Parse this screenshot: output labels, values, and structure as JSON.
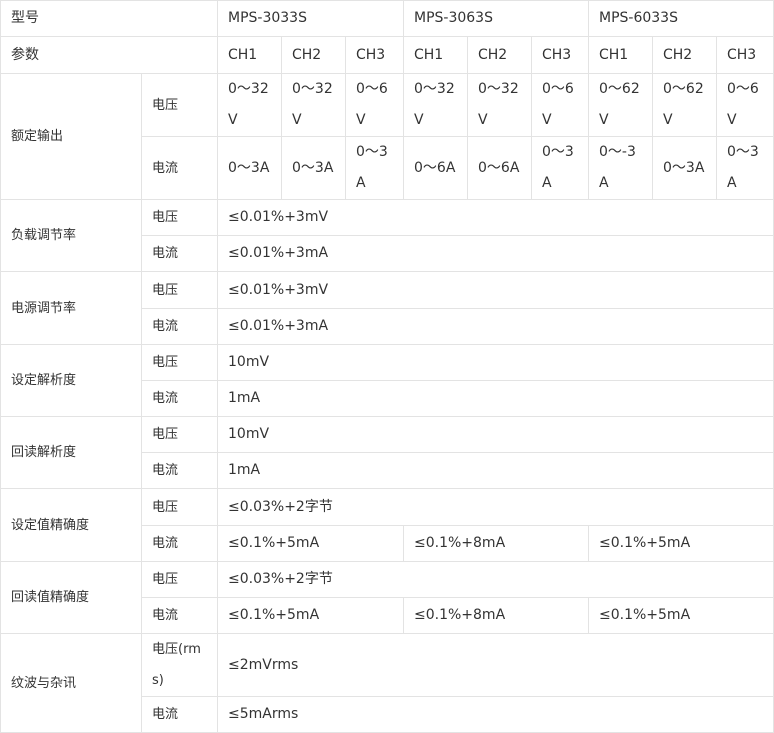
{
  "header": {
    "model_label": "型号",
    "models": [
      "MPS-3033S",
      "MPS-3063S",
      "MPS-6033S"
    ],
    "param_label": "参数",
    "channels": [
      "CH1",
      "CH2",
      "CH3",
      "CH1",
      "CH2",
      "CH3",
      "CH1",
      "CH2",
      "CH3"
    ]
  },
  "rated_output": {
    "label": "额定输出",
    "voltage_label": "电压",
    "voltage_values": [
      "0～32V",
      "0～32V",
      "0～6V",
      "0～32V",
      "0～32V",
      "0～6V",
      "0～62V",
      "0～62V",
      "0～6V"
    ],
    "current_label": "电流",
    "current_values": [
      "0～3A",
      "0～3A",
      "0～3A",
      "0～6A",
      "0～6A",
      "0～3A",
      "0～-3A",
      "0～3A",
      "0～3A"
    ]
  },
  "rows": {
    "load_regulation": {
      "label": "负载调节率",
      "voltage_label": "电压",
      "voltage": "≤0.01%+3mV",
      "current_label": "电流",
      "current": "≤0.01%+3mA"
    },
    "source_regulation": {
      "label": "电源调节率",
      "voltage_label": "电压",
      "voltage": "≤0.01%+3mV",
      "current_label": "电流",
      "current": "≤0.01%+3mA"
    },
    "set_resolution": {
      "label": "设定解析度",
      "voltage_label": "电压",
      "voltage": "10mV",
      "current_label": "电流",
      "current": "1mA"
    },
    "readback_resolution": {
      "label": "回读解析度",
      "voltage_label": "电压",
      "voltage": "10mV",
      "current_label": "电流",
      "current": "1mA"
    },
    "set_accuracy": {
      "label": "设定值精确度",
      "voltage_label": "电压",
      "voltage": "≤0.03%+2字节",
      "current_label": "电流",
      "current": [
        "≤0.1%+5mA",
        "≤0.1%+8mA",
        "≤0.1%+5mA"
      ]
    },
    "readback_accuracy": {
      "label": "回读值精确度",
      "voltage_label": "电压",
      "voltage": "≤0.03%+2字节",
      "current_label": "电流",
      "current": [
        "≤0.1%+5mA",
        "≤0.1%+8mA",
        "≤0.1%+5mA"
      ]
    },
    "ripple_noise": {
      "label": "纹波与杂讯",
      "voltage_label": "电压(rms)",
      "voltage": "≤2mVrms",
      "current_label": "电流",
      "current": "≤5mArms"
    }
  }
}
